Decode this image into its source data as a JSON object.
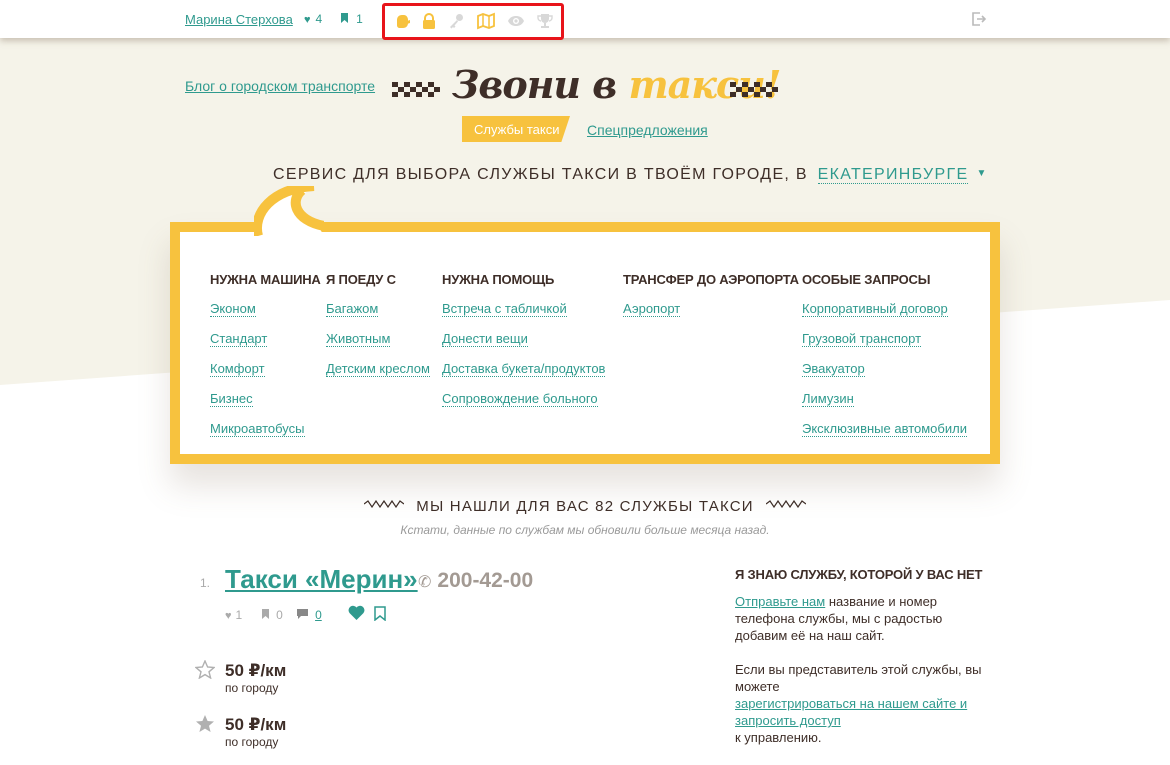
{
  "topbar": {
    "user_name": "Марина Стерхова",
    "likes_count": "4",
    "bookmarks_count": "1",
    "achievement_icons": [
      "hand-icon",
      "lock-icon",
      "key-icon",
      "map-icon",
      "eye-icon",
      "trophy-icon"
    ]
  },
  "header": {
    "blog_link": "Блог о городском транспорте",
    "logo_part1": "Звони в",
    "logo_part2": "такси!",
    "nav": {
      "active": "Службы такси",
      "other": "Спецпредложения"
    },
    "tagline": "СЕРВИС ДЛЯ ВЫБОРА СЛУЖБЫ ТАКСИ В ТВОЁМ ГОРОДЕ, В",
    "city": "ЕКАТЕРИНБУРГЕ"
  },
  "categories": [
    {
      "title": "НУЖНА МАШИНА",
      "items": [
        "Эконом",
        "Стандарт",
        "Комфорт",
        "Бизнес",
        "Микроавтобусы"
      ]
    },
    {
      "title": "Я ПОЕДУ С",
      "items": [
        "Багажом",
        "Животным",
        "Детским креслом"
      ]
    },
    {
      "title": "НУЖНА ПОМОЩЬ",
      "items": [
        "Встреча с табличкой",
        "Донести вещи",
        "Доставка букета/продуктов",
        "Сопровождение больного"
      ]
    },
    {
      "title": "ТРАНСФЕР ДО АЭРОПОРТА",
      "items": [
        "Аэропорт"
      ]
    },
    {
      "title": "ОСОБЫЕ ЗАПРОСЫ",
      "items": [
        "Корпоративный договор",
        "Грузовой транспорт",
        "Эвакуатор",
        "Лимузин",
        "Эксклюзивные автомобили"
      ]
    }
  ],
  "results": {
    "found_text": "МЫ НАШЛИ ДЛЯ ВАС 82 СЛУЖБЫ ТАКСИ",
    "updated_text": "Кстати, данные по службам мы обновили больше месяца назад.",
    "service": {
      "rank": "1.",
      "name": "Такси «Мерин»",
      "phone": "200-42-00",
      "likes": "1",
      "bookmarks": "0",
      "comments": "0",
      "prices": [
        {
          "value": "50 ₽/км",
          "note": "по городу"
        },
        {
          "value": "50 ₽/км",
          "note": "по городу"
        }
      ]
    }
  },
  "sidebox": {
    "title": "Я ЗНАЮ СЛУЖБУ, КОТОРОЙ У ВАС НЕТ",
    "send_link": "Отправьте нам",
    "send_text": "название и номер телефона службы, мы с радостью добавим её на наш сайт.",
    "rep_text": "Если вы представитель этой службы, вы можете",
    "register_link": "зарегистрироваться на нашем сайте и запросить доступ",
    "register_tail": "к управлению."
  },
  "colors": {
    "accent_teal": "#2f9a8e",
    "accent_yellow": "#f7c23e",
    "dark_brown": "#3e2e28",
    "highlight_red": "#e8141a",
    "band_bg": "#f5f3e9"
  }
}
